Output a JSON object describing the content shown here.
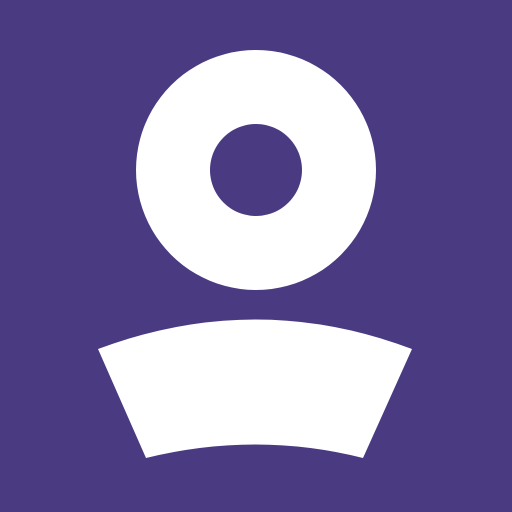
{
  "icon": {
    "name": "user-profile-icon",
    "background_color": "#4a3a82",
    "foreground_color": "#ffffff"
  }
}
